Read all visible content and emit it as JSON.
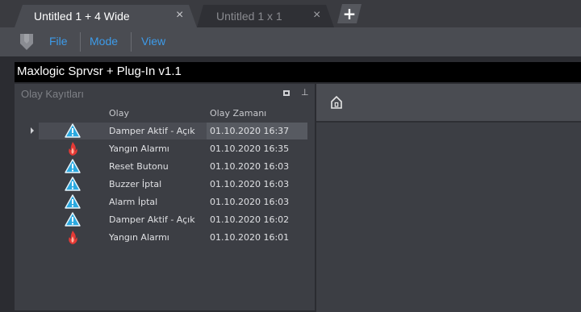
{
  "tabs": [
    {
      "label": "Untitled 1 + 4 Wide",
      "close": "×",
      "active": true
    },
    {
      "label": "Untitled 1 x 1",
      "close": "×",
      "active": false
    }
  ],
  "new_tab": "+",
  "menu": {
    "items": [
      "File",
      "Mode",
      "View"
    ]
  },
  "app_title": "Maxlogic Sprvsr + Plug-In v1.1",
  "event_log": {
    "title": "Olay Kayıtları",
    "columns": [
      "Olay",
      "Olay Zamanı"
    ],
    "rows": [
      {
        "event": "Damper Aktif - Açık",
        "time": "01.10.2020 16:37",
        "icon": "warning-icon",
        "selected": true
      },
      {
        "event": "Yangın Alarmı",
        "time": "01.10.2020 16:35",
        "icon": "fire-icon"
      },
      {
        "event": "Reset Butonu",
        "time": "01.10.2020 16:03",
        "icon": "warning-icon"
      },
      {
        "event": "Buzzer İptal",
        "time": "01.10.2020 16:03",
        "icon": "warning-icon"
      },
      {
        "event": "Alarm İptal",
        "time": "01.10.2020 16:03",
        "icon": "warning-icon"
      },
      {
        "event": "Damper Aktif - Açık",
        "time": "01.10.2020 16:02",
        "icon": "warning-icon"
      },
      {
        "event": "Yangın Alarmı",
        "time": "01.10.2020 16:01",
        "icon": "fire-icon"
      }
    ]
  },
  "colors": {
    "accent": "#3d9be9",
    "warning": "#2aa9e0",
    "fire": "#e53935"
  }
}
